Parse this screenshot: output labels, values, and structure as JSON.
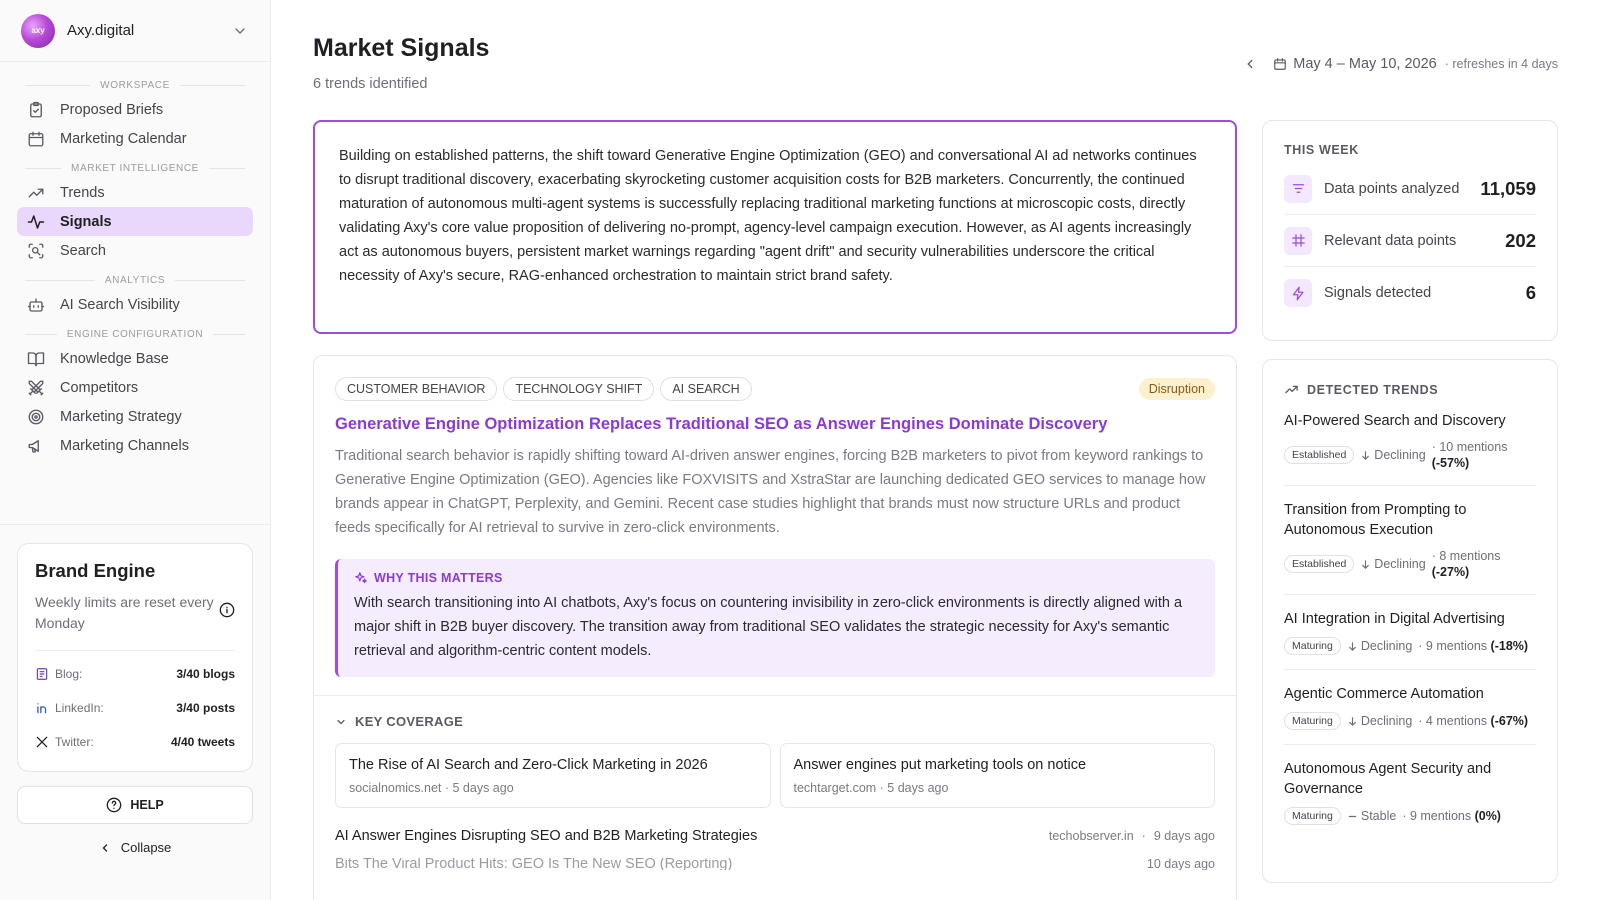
{
  "org": {
    "name": "Axy.digital",
    "avatar_text": "axy"
  },
  "sidebar": {
    "sections": [
      {
        "label": "WORKSPACE",
        "items": [
          {
            "label": "Proposed Briefs",
            "icon": "clipboard-check-icon"
          },
          {
            "label": "Marketing Calendar",
            "icon": "calendar-icon"
          }
        ]
      },
      {
        "label": "MARKET INTELLIGENCE",
        "items": [
          {
            "label": "Trends",
            "icon": "trending-up-icon"
          },
          {
            "label": "Signals",
            "icon": "activity-icon",
            "active": true
          },
          {
            "label": "Search",
            "icon": "scan-search-icon"
          }
        ]
      },
      {
        "label": "ANALYTICS",
        "items": [
          {
            "label": "AI Search Visibility",
            "icon": "bot-icon"
          }
        ]
      },
      {
        "label": "ENGINE CONFIGURATION",
        "items": [
          {
            "label": "Knowledge Base",
            "icon": "book-open-icon"
          },
          {
            "label": "Competitors",
            "icon": "swords-icon"
          },
          {
            "label": "Marketing Strategy",
            "icon": "target-icon"
          },
          {
            "label": "Marketing Channels",
            "icon": "megaphone-icon"
          }
        ]
      }
    ]
  },
  "brand_engine": {
    "title": "Brand Engine",
    "subtitle": "Weekly limits are reset every Monday",
    "limits": [
      {
        "label": "Blog:",
        "value": "3/40 blogs",
        "icon": "blog-icon"
      },
      {
        "label": "LinkedIn:",
        "value": "3/40 posts",
        "icon": "linkedin-icon"
      },
      {
        "label": "Twitter:",
        "value": "4/40 tweets",
        "icon": "x-icon"
      }
    ],
    "help_label": "HELP",
    "collapse_label": "Collapse"
  },
  "header": {
    "title": "Market Signals",
    "subtitle": "6 trends identified",
    "date_range": "May 4 – May 10, 2026",
    "refresh": "· refreshes in 4 days"
  },
  "summary": "Building on established patterns, the shift toward Generative Engine Optimization (GEO) and conversational AI ad networks continues to disrupt traditional discovery, exacerbating skyrocketing customer acquisition costs for B2B marketers. Concurrently, the continued maturation of autonomous multi-agent systems is successfully replacing traditional marketing functions at microscopic costs, directly validating Axy's core value proposition of delivering no-prompt, agency-level campaign execution. However, as AI agents increasingly act as autonomous buyers, persistent market warnings regarding \"agent drift\" and security vulnerabilities underscore the critical necessity of Axy's secure, RAG-enhanced orchestration to maintain strict brand safety.",
  "signal": {
    "tags": [
      "CUSTOMER BEHAVIOR",
      "TECHNOLOGY SHIFT",
      "AI SEARCH"
    ],
    "badge": "Disruption",
    "title": "Generative Engine Optimization Replaces Traditional SEO as Answer Engines Dominate Discovery",
    "description": "Traditional search behavior is rapidly shifting toward AI-driven answer engines, forcing B2B marketers to pivot from keyword rankings to Generative Engine Optimization (GEO). Agencies like FOXVISITS and XstraStar are launching dedicated GEO services to manage how brands appear in ChatGPT, Perplexity, and Gemini. Recent case studies highlight that brands must now structure URLs and product feeds specifically for AI retrieval to survive in zero-click environments.",
    "why_label": "WHY THIS MATTERS",
    "why_text": "With search transitioning into AI chatbots, Axy's focus on countering invisibility in zero-click environments is directly aligned with a major shift in B2B buyer discovery. The transition away from traditional SEO validates the strategic necessity for Axy's semantic retrieval and algorithm-centric content models.",
    "coverage_label": "KEY COVERAGE",
    "coverage_cards": [
      {
        "title": "The Rise of AI Search and Zero-Click Marketing in 2026",
        "meta": "socialnomics.net · 5 days ago"
      },
      {
        "title": "Answer engines put marketing tools on notice",
        "meta": "techtarget.com · 5 days ago"
      }
    ],
    "coverage_rows": [
      {
        "title": "AI Answer Engines Disrupting SEO and B2B Marketing Strategies",
        "source": "techobserver.in",
        "age": "9 days ago"
      },
      {
        "title": "Bits The Viral Product Hits: GEO Is The New SEO (Reporting)",
        "source": "",
        "age": "10 days ago"
      }
    ]
  },
  "this_week": {
    "label": "THIS WEEK",
    "stats": [
      {
        "label": "Data points analyzed",
        "value": "11,059",
        "icon": "list-filter-icon"
      },
      {
        "label": "Relevant data points",
        "value": "202",
        "icon": "frame-icon"
      },
      {
        "label": "Signals detected",
        "value": "6",
        "icon": "zap-icon"
      }
    ]
  },
  "detected_trends": {
    "label": "DETECTED TRENDS",
    "items": [
      {
        "name": "AI-Powered Search and Discovery",
        "stage": "Established",
        "direction": "Declining",
        "mentions": "· 10 mentions",
        "change": "(-57%)"
      },
      {
        "name": "Transition from Prompting to Autonomous Execution",
        "stage": "Established",
        "direction": "Declining",
        "mentions": "· 8 mentions",
        "change": "(-27%)"
      },
      {
        "name": "AI Integration in Digital Advertising",
        "stage": "Maturing",
        "direction": "Declining",
        "mentions": "· 9 mentions",
        "change": "(-18%)"
      },
      {
        "name": "Agentic Commerce Automation",
        "stage": "Maturing",
        "direction": "Declining",
        "mentions": "· 4 mentions",
        "change": "(-67%)"
      },
      {
        "name": "Autonomous Agent Security and Governance",
        "stage": "Maturing",
        "direction": "Stable",
        "mentions": "· 9 mentions",
        "change": "(0%)"
      }
    ]
  },
  "colors": {
    "accent": "#8b3ad6",
    "active_bg": "#e9d8fb",
    "badge_bg": "#fdf0cf"
  }
}
